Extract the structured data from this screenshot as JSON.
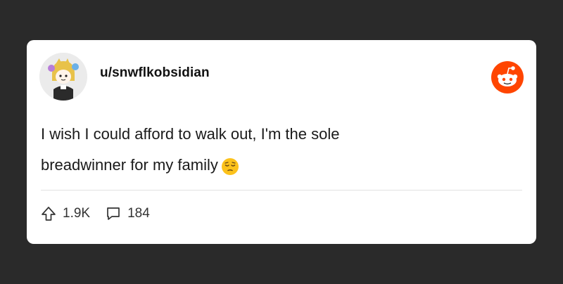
{
  "post": {
    "username": "u/snwflkobsidian",
    "line1": "I wish I could afford to walk out, I'm the sole",
    "line2": "breadwinner for my family",
    "emoji": "pensive-face"
  },
  "stats": {
    "upvotes": "1.9K",
    "comments": "184"
  },
  "colors": {
    "background": "#2a2a2a",
    "card": "#ffffff",
    "brand": "#ff4500"
  },
  "icons": [
    "avatar",
    "reddit-logo-icon",
    "pensive-emoji-icon",
    "upvote-arrow-icon",
    "comment-bubble-icon"
  ]
}
